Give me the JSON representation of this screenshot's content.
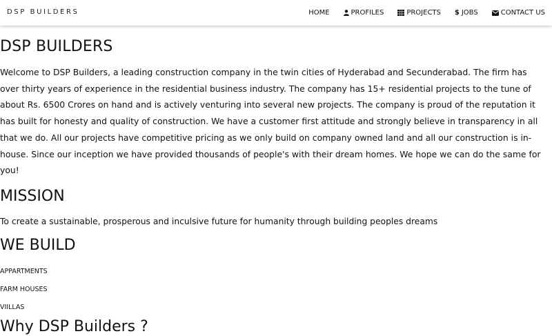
{
  "navbar": {
    "brand": "DSP BUILDERS",
    "items": [
      {
        "label": "HOME",
        "icon": null
      },
      {
        "label": "PROFILES",
        "icon": "user-icon"
      },
      {
        "label": "PROJECTS",
        "icon": "grid-icon"
      },
      {
        "label": "JOBS",
        "icon": "dollar-icon"
      },
      {
        "label": "CONTACT US",
        "icon": "envelope-icon"
      }
    ]
  },
  "main": {
    "title": "DSP BUILDERS",
    "intro": "Welcome to DSP Builders, a leading construction company in the twin cities of Hyderabad and Secunderabad. The firm has over thirty years of experience in the residential business industry. The company has 15+ residential projects to the tune of about Rs. 6500 Crores on hand and is actively venturing into several new projects. The company is proud of the reputation it has built for honesty and quality of construction. We have a customer first attitude and strongly believe in transparency in all that we do. All our projects have competitive pricing as we only build on company owned land and all our construction is in-house. Since our inception we have provided thousands of people's with their dream homes. We hope we can do the same for you!",
    "mission_heading": "MISSION",
    "mission_text": "To create a sustainable, prosperous and inculsive future for humanity through building peoples dreams",
    "build_heading": "WE BUILD",
    "build_items": [
      "APPARTMENTS",
      "FARM HOUSES",
      "VIILLAS"
    ],
    "next_heading": "Why DSP Builders ?"
  }
}
